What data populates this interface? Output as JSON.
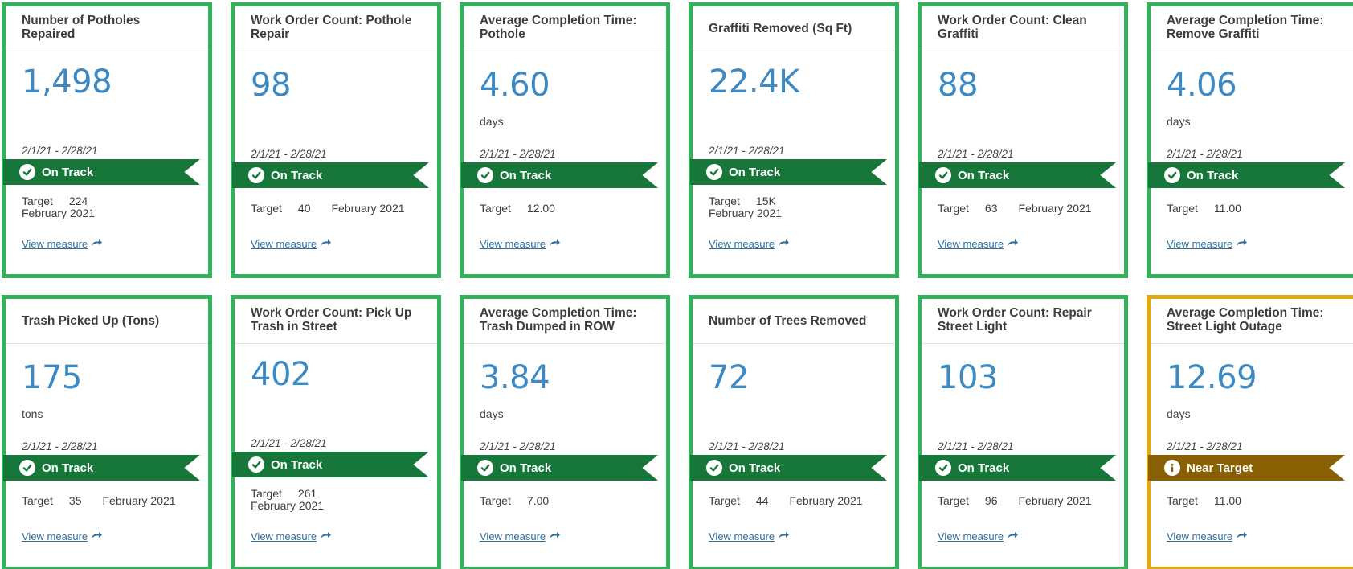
{
  "cards": [
    {
      "title": "Number of Potholes Repaired",
      "value": "1,498",
      "unit": "",
      "period": "2/1/21 - 2/28/21",
      "status": "On Track",
      "target_label": "Target",
      "target_value": "224",
      "target_period": "February 2021",
      "link": "View measure"
    },
    {
      "title": "Work Order Count: Pothole Repair",
      "value": "98",
      "unit": "",
      "period": "2/1/21 - 2/28/21",
      "status": "On Track",
      "target_label": "Target",
      "target_value": "40",
      "target_period": "February 2021",
      "link": "View measure"
    },
    {
      "title": "Average Completion Time: Pothole",
      "value": "4.60",
      "unit": "days",
      "period": "2/1/21 - 2/28/21",
      "status": "On Track",
      "target_label": "Target",
      "target_value": "12.00",
      "target_period": "",
      "link": "View measure"
    },
    {
      "title": "Graffiti Removed (Sq Ft)",
      "value": "22.4K",
      "unit": "",
      "period": "2/1/21 - 2/28/21",
      "status": "On Track",
      "target_label": "Target",
      "target_value": "15K",
      "target_period": "February 2021",
      "link": "View measure"
    },
    {
      "title": "Work Order Count: Clean Graffiti",
      "value": "88",
      "unit": "",
      "period": "2/1/21 - 2/28/21",
      "status": "On Track",
      "target_label": "Target",
      "target_value": "63",
      "target_period": "February 2021",
      "link": "View measure"
    },
    {
      "title": "Average Completion Time: Remove Graffiti",
      "value": "4.06",
      "unit": "days",
      "period": "2/1/21 - 2/28/21",
      "status": "On Track",
      "target_label": "Target",
      "target_value": "11.00",
      "target_period": "",
      "link": "View measure"
    },
    {
      "title": "Trash Picked Up (Tons)",
      "value": "175",
      "unit": "tons",
      "period": "2/1/21 - 2/28/21",
      "status": "On Track",
      "target_label": "Target",
      "target_value": "35",
      "target_period": "February 2021",
      "link": "View measure"
    },
    {
      "title": "Work Order Count: Pick Up Trash in Street",
      "value": "402",
      "unit": "",
      "period": "2/1/21 - 2/28/21",
      "status": "On Track",
      "target_label": "Target",
      "target_value": "261",
      "target_period": "February 2021",
      "link": "View measure"
    },
    {
      "title": "Average Completion Time: Trash Dumped in ROW",
      "value": "3.84",
      "unit": "days",
      "period": "2/1/21 - 2/28/21",
      "status": "On Track",
      "target_label": "Target",
      "target_value": "7.00",
      "target_period": "",
      "link": "View measure"
    },
    {
      "title": "Number of Trees Removed",
      "value": "72",
      "unit": "",
      "period": "2/1/21 - 2/28/21",
      "status": "On Track",
      "target_label": "Target",
      "target_value": "44",
      "target_period": "February 2021",
      "link": "View measure"
    },
    {
      "title": "Work Order Count: Repair Street Light",
      "value": "103",
      "unit": "",
      "period": "2/1/21 - 2/28/21",
      "status": "On Track",
      "target_label": "Target",
      "target_value": "96",
      "target_period": "February 2021",
      "link": "View measure"
    },
    {
      "title": "Average Completion Time: Street Light Outage",
      "value": "12.69",
      "unit": "days",
      "period": "2/1/21 - 2/28/21",
      "status": "Near Target",
      "target_label": "Target",
      "target_value": "11.00",
      "target_period": "",
      "link": "View measure"
    }
  ],
  "colors": {
    "on_track": "#17773a",
    "near_target": "#8a6004",
    "border_on_track": "#33b25b",
    "border_near_target": "#e4a711",
    "value": "#3d89c4"
  },
  "icons": {
    "on_track": "check-circle-icon",
    "near_target": "info-circle-icon",
    "link": "arrow-right-icon"
  }
}
